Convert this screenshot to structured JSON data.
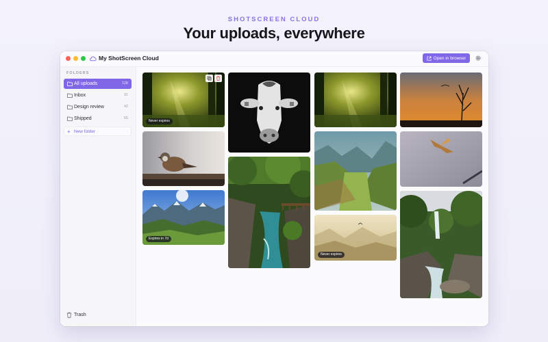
{
  "hero": {
    "eyebrow": "SHOTSCREEN CLOUD",
    "title": "Your uploads, everywhere"
  },
  "window": {
    "title": "My ShotScreen Cloud",
    "open_button": "Open in browser",
    "icons": [
      "cloud-icon",
      "external-link-icon",
      "gear-icon"
    ]
  },
  "sidebar": {
    "heading": "FOLDERS",
    "items": [
      {
        "label": "All uploads",
        "count": "128",
        "active": true
      },
      {
        "label": "Inbox",
        "count": "31"
      },
      {
        "label": "Design review",
        "count": "42"
      },
      {
        "label": "Shipped",
        "count": "55"
      }
    ],
    "new_folder": "New folder",
    "trash": "Trash"
  },
  "gallery": {
    "tiles": [
      {
        "subject": "forest sunbeams",
        "badge": "Never expires",
        "hovered": true
      },
      {
        "subject": "sparrow on branch"
      },
      {
        "subject": "mountain valley sunburst",
        "badge": "Expires in 7d"
      },
      {
        "subject": "black and white cow"
      },
      {
        "subject": "forest river gorge"
      },
      {
        "subject": "forest sunbeams"
      },
      {
        "subject": "green alpine valley"
      },
      {
        "subject": "misty mountains",
        "badge": "Never expires"
      },
      {
        "subject": "sunset dead tree"
      },
      {
        "subject": "bird in flight"
      },
      {
        "subject": "waterfall forest"
      }
    ]
  },
  "colors": {
    "accent": "#7f67e8",
    "eyebrow": "#8a72e6",
    "window_bg": "#ffffff",
    "sidebar_bg": "#f6f6f9"
  }
}
